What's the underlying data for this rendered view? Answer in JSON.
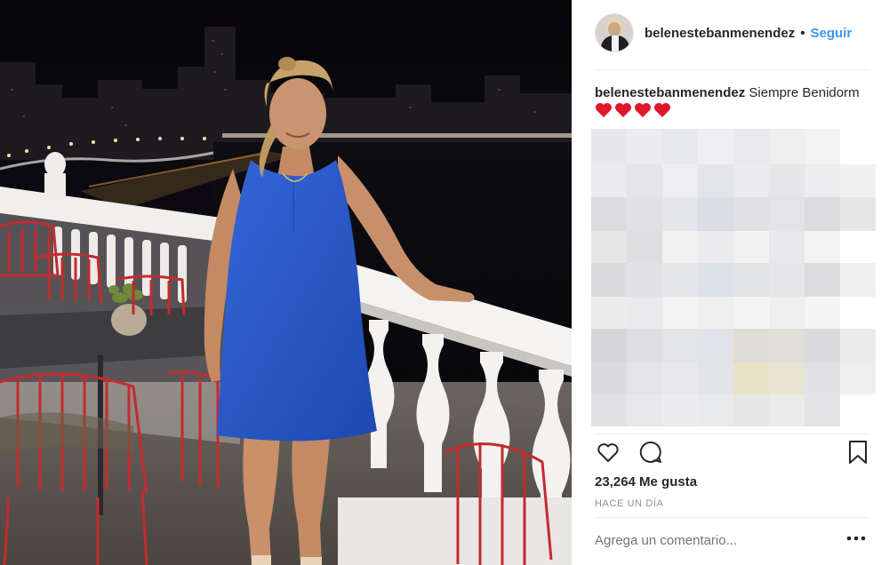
{
  "header": {
    "username": "belenestebanmenendez",
    "separator": "•",
    "follow_label": "Seguir"
  },
  "caption": {
    "username": "belenestebanmenendez",
    "text": "Siempre Benidorm",
    "emoji": [
      "red-heart",
      "red-heart",
      "red-heart",
      "red-heart"
    ]
  },
  "stats": {
    "likes": "23,264 Me gusta",
    "time_ago": "HACE UN DÍA"
  },
  "comment": {
    "placeholder": "Agrega un comentario..."
  },
  "icons": {
    "like": "heart-outline-icon",
    "comment": "comment-bubble-icon",
    "save": "bookmark-icon",
    "more": "more-options-icon"
  },
  "colors": {
    "link_blue": "#3897f0",
    "muted_gray": "#8e8e8e",
    "text_dark": "#262626",
    "heart_red": "#e0162b",
    "dress_blue": "#2a58c8"
  }
}
